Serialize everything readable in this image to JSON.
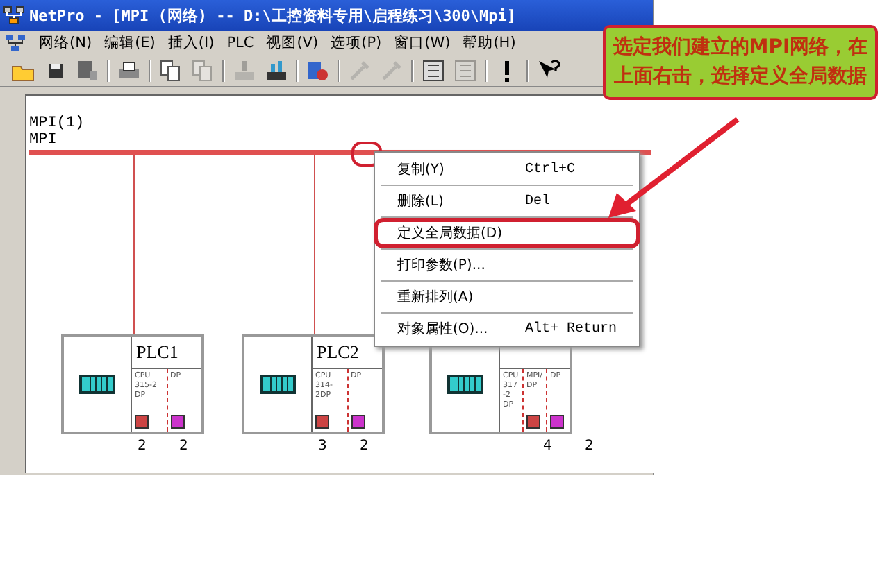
{
  "window": {
    "title": "NetPro - [MPI (网络) -- D:\\工控资料专用\\启程练习\\300\\Mpi]"
  },
  "menu_bar": [
    "网络(N)",
    "编辑(E)",
    "插入(I)",
    "PLC",
    "视图(V)",
    "选项(P)",
    "窗口(W)",
    "帮助(H)"
  ],
  "toolbar": [
    [
      {
        "kind": "open",
        "disabled": false
      },
      {
        "kind": "save",
        "disabled": false
      },
      {
        "kind": "compile",
        "disabled": false
      }
    ],
    [
      {
        "kind": "print",
        "disabled": false
      }
    ],
    [
      {
        "kind": "copy",
        "disabled": false
      },
      {
        "kind": "paste",
        "disabled": true
      }
    ],
    [
      {
        "kind": "download",
        "disabled": true
      },
      {
        "kind": "upload",
        "disabled": false
      }
    ],
    [
      {
        "kind": "station",
        "disabled": false
      }
    ],
    [
      {
        "kind": "wrench",
        "disabled": true
      },
      {
        "kind": "wrench",
        "disabled": true
      }
    ],
    [
      {
        "kind": "catalog",
        "disabled": false
      },
      {
        "kind": "catalog",
        "disabled": true
      }
    ],
    [
      {
        "kind": "exclamation",
        "disabled": false
      }
    ],
    [
      {
        "kind": "help",
        "disabled": false
      }
    ]
  ],
  "network": {
    "name": "MPI(1)",
    "type": "MPI",
    "stations": [
      {
        "name": "PLC1",
        "columns": [
          {
            "text": "CPU 315-2 DP",
            "color": "#cc4444",
            "address": "2"
          },
          {
            "text": "DP",
            "color": "#cc33cc",
            "address": "2"
          }
        ]
      },
      {
        "name": "PLC2",
        "columns": [
          {
            "text": "CPU 314-2DP",
            "color": "#cc4444",
            "address": "3"
          },
          {
            "text": "DP",
            "color": "#cc33cc",
            "address": "2"
          }
        ]
      },
      {
        "columns": [
          {
            "text": "CPU 317-2 DP"
          },
          {
            "text": "MPI/DP",
            "color": "#cc4444",
            "address": "4"
          },
          {
            "text": "DP",
            "color": "#cc33cc",
            "address": "2"
          }
        ]
      }
    ]
  },
  "context_menu": [
    {
      "label": "复制(Y)",
      "shortcut": "Ctrl+C",
      "selected": false
    },
    {
      "label": "删除(L)",
      "shortcut": "Del",
      "selected": false
    },
    {
      "label": "定义全局数据(D)",
      "selected": true
    },
    {
      "label": "打印参数(P)...",
      "selected": false
    },
    {
      "label": "重新排列(A)",
      "selected": false
    },
    {
      "label": "对象属性(O)...",
      "shortcut": "Alt+ Return",
      "selected": false
    }
  ],
  "callout": "选定我们建立的MPI网络，在上面右击，选择定义全局数据"
}
